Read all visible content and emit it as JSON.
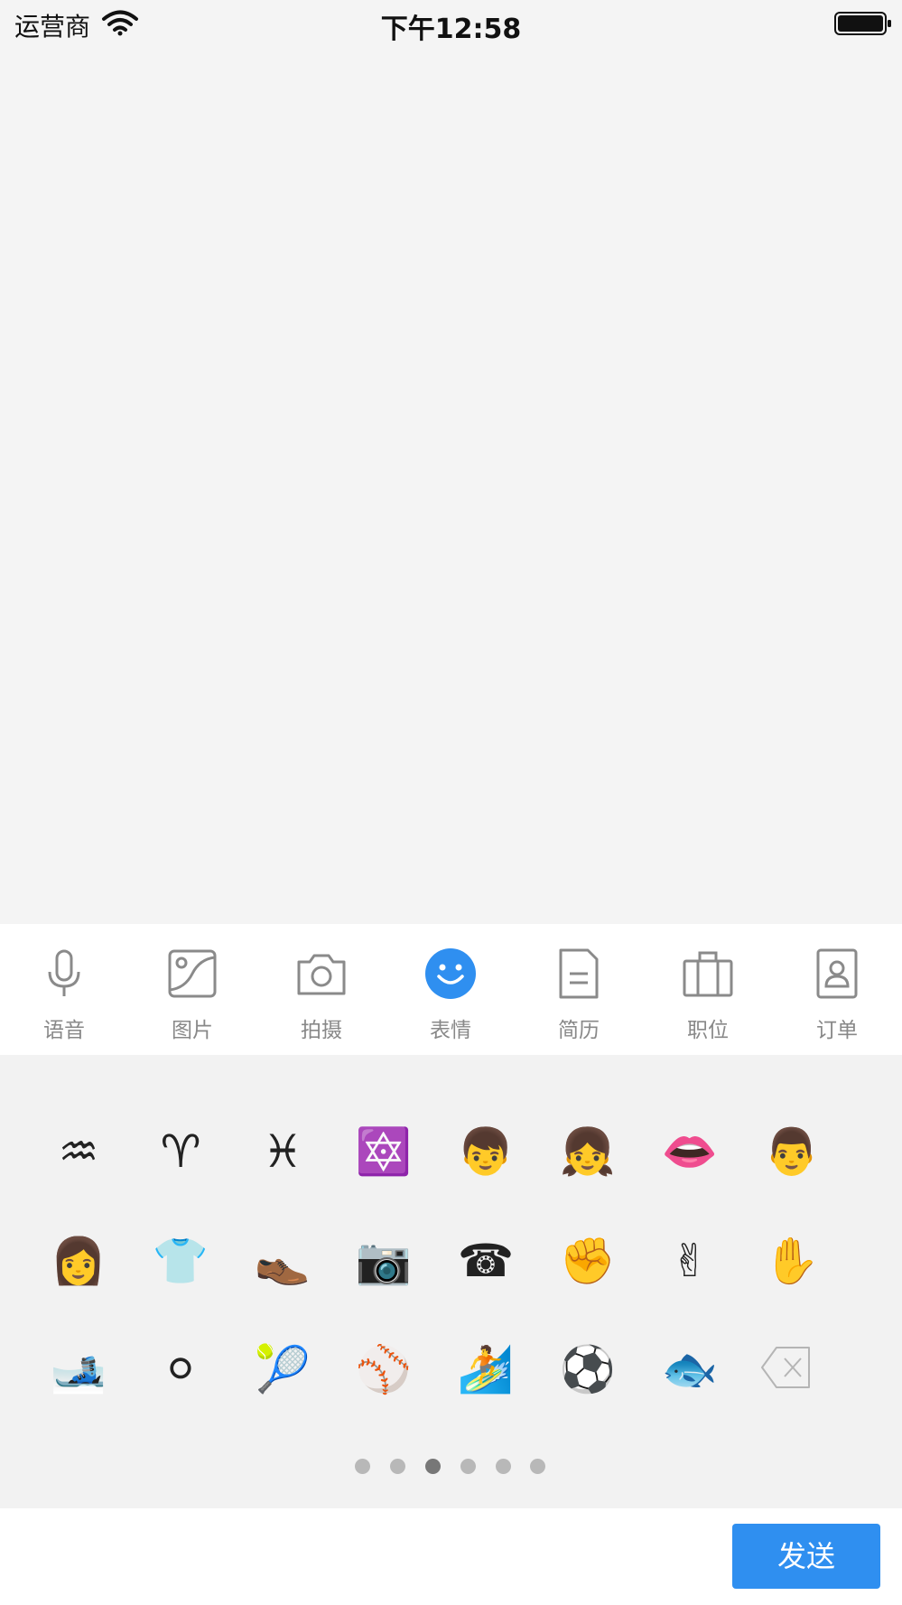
{
  "status_bar": {
    "carrier": "运营商",
    "time": "下午12:58"
  },
  "toolbar": {
    "accent_color": "#2f8ff0",
    "items": [
      {
        "label": "语音",
        "icon": "microphone-icon"
      },
      {
        "label": "图片",
        "icon": "image-icon"
      },
      {
        "label": "拍摄",
        "icon": "camera-icon"
      },
      {
        "label": "表情",
        "icon": "smiley-icon",
        "selected": true
      },
      {
        "label": "简历",
        "icon": "document-icon"
      },
      {
        "label": "职位",
        "icon": "briefcase-icon"
      },
      {
        "label": "订单",
        "icon": "order-icon"
      }
    ]
  },
  "emoji_panel": {
    "rows": [
      [
        "♒",
        "♈",
        "♓",
        "🔯",
        "👦",
        "👧",
        "👄",
        "👨"
      ],
      [
        "👩",
        "👕",
        "👞",
        "📷",
        "☎",
        "✊",
        "✌",
        "✋"
      ],
      [
        "🎿",
        "⚪",
        "🎾",
        "⚾",
        "🏄",
        "⚽",
        "🐟"
      ]
    ],
    "page_count": 6,
    "current_page": 3
  },
  "bottom_bar": {
    "send_label": "发送"
  }
}
